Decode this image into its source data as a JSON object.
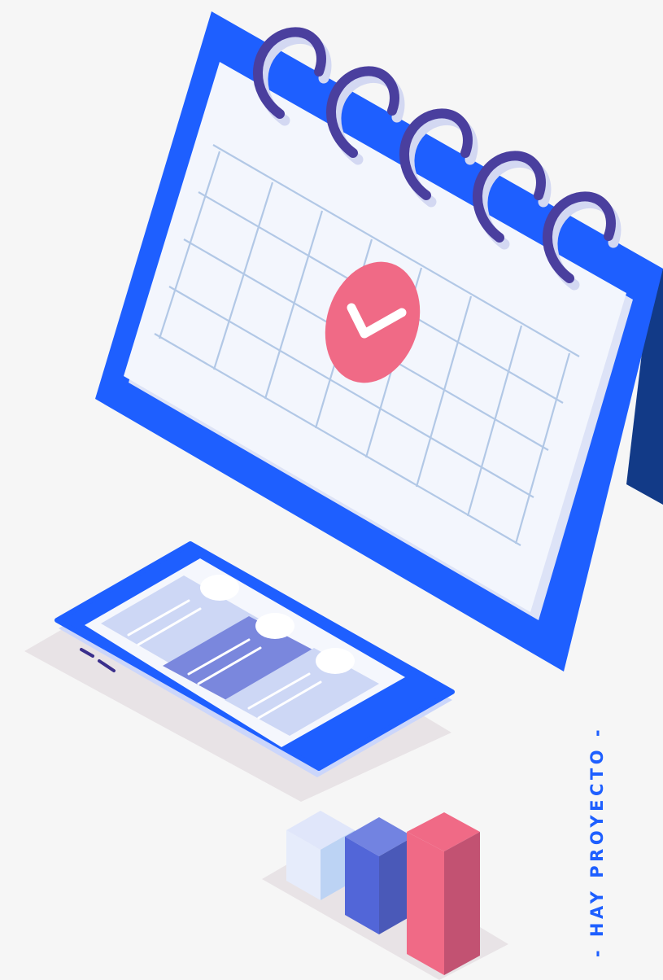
{
  "tagline": "- HAY PROYECTO -",
  "colors": {
    "background": "#f6f6f6",
    "brand_blue": "#1e5fff",
    "dark_blue": "#123a87",
    "calendar_page": "#f3f6fd",
    "grid_line": "#b2c8e6",
    "ring_purple": "#4a3f9e",
    "check_red": "#f06a86",
    "shadow": "#e8e3e6",
    "card_light": "#cdd7f5",
    "card_dark": "#7a87dd"
  },
  "icons": {
    "calendar": "calendar-icon",
    "check": "check-icon",
    "phone": "smartphone-icon",
    "chart": "bar-chart-icon"
  }
}
